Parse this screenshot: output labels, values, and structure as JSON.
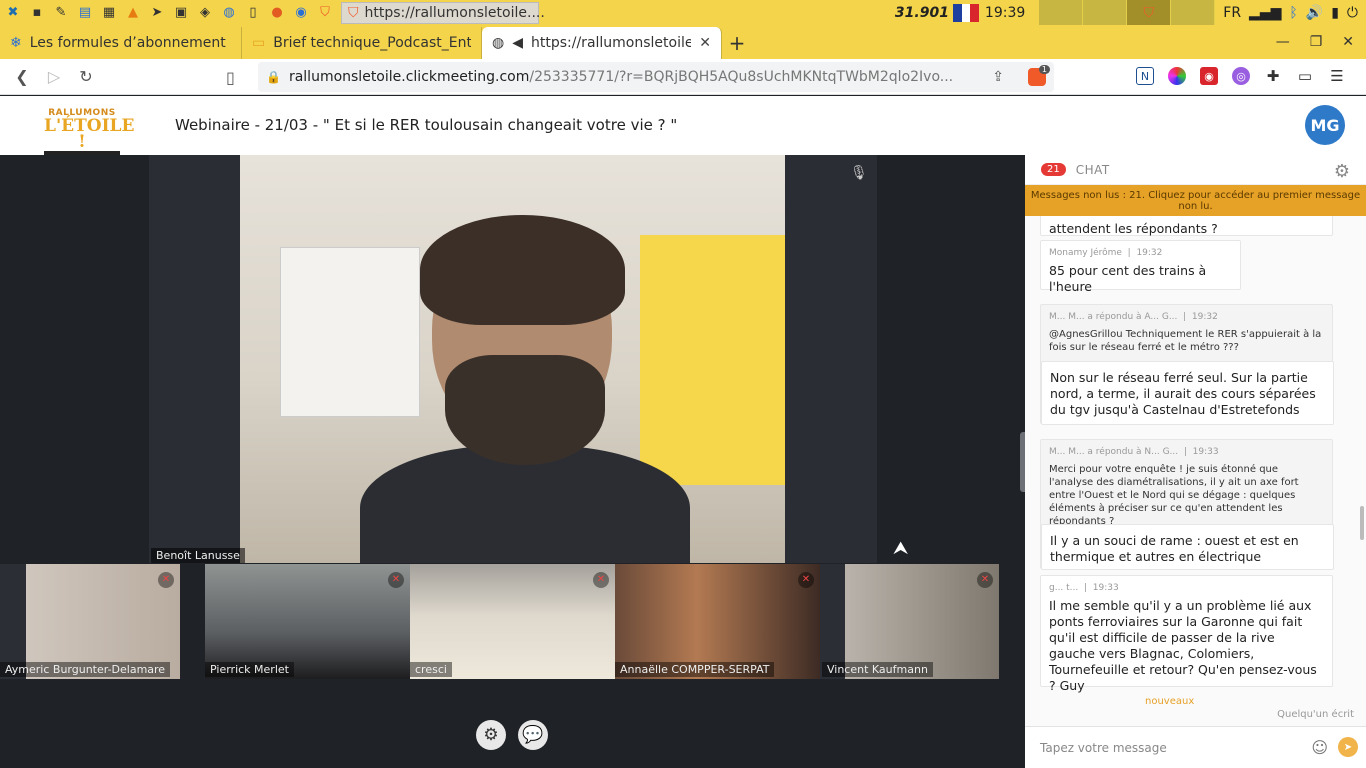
{
  "system_panel": {
    "window_title": "https://rallumonsletoile....",
    "counter": "31.901",
    "time": "19:39",
    "lang": "FR"
  },
  "tabs": [
    {
      "title": "Les formules d’abonnement | M"
    },
    {
      "title": "Brief technique_Podcast_Entrai"
    },
    {
      "title": "https://rallumonsletoile.cl"
    }
  ],
  "address_bar": {
    "host": "rallumonsletoile.clickmeeting.com",
    "path": "/253335771/?r=BQRjBQH5AQu8sUchMKNtqTWbM2qlo2Ivo...",
    "brave_badge": "1"
  },
  "webinar": {
    "logo_line1": "RALLUMONS",
    "logo_line2": "L'ÉTOILE !",
    "title": "Webinaire - 21/03 - \" Et si le RER toulousain changeait votre vie ? \"",
    "avatar_initials": "MG",
    "speaker_name": "Benoît Lanusse"
  },
  "participants": [
    {
      "name": "Aymeric Burgunter-Delamare"
    },
    {
      "name": "Pierrick Merlet"
    },
    {
      "name": "cresci"
    },
    {
      "name": "Annaëlle COMPPER-SERPAT"
    },
    {
      "name": "Vincent Kaufmann"
    }
  ],
  "chat": {
    "unread_count": "21",
    "tab_label": "CHAT",
    "unread_banner": "Messages non lus : 21. Cliquez pour accéder au premier message non lu.",
    "partial_top": "attendent les répondants ?",
    "messages": [
      {
        "author": "Monamy Jérôme",
        "time": "19:32",
        "text": "85 pour cent des trains à l'heure"
      },
      {
        "author": "M... M... a répondu à A... G...",
        "time": "19:32",
        "quote": "@AgnesGrillou Techniquement le RER s'appuierait à la fois sur le réseau ferré et le métro ???",
        "text": "Non sur le réseau ferré seul. Sur la partie nord, a terme, il aurait des cours séparées  du tgv jusqu'à Castelnau d'Estretefonds"
      },
      {
        "author": "M... M... a répondu à N... G...",
        "time": "19:33",
        "quote": "Merci pour votre enquête ! je suis étonné que l'analyse des diamétralisations, il y ait un axe fort entre l'Ouest et le Nord qui se dégage : quelques éléments à préciser sur ce qu'en attendent les répondants ?",
        "text": "Il y a un souci de rame : ouest et est en thermique et autres en électrique"
      },
      {
        "author": "g... t...",
        "time": "19:33",
        "text": "Il me semble qu'il y a un problème lié aux ponts ferroviaires sur la Garonne qui fait qu'il est difficile de passer de la rive gauche vers Blagnac, Colomiers, Tournefeuille et retour? Qu'en pensez-vous ? Guy"
      }
    ],
    "nouveaux_label": "nouveaux",
    "writing_label": "Quelqu'un écrit",
    "input_placeholder": "Tapez votre message"
  }
}
